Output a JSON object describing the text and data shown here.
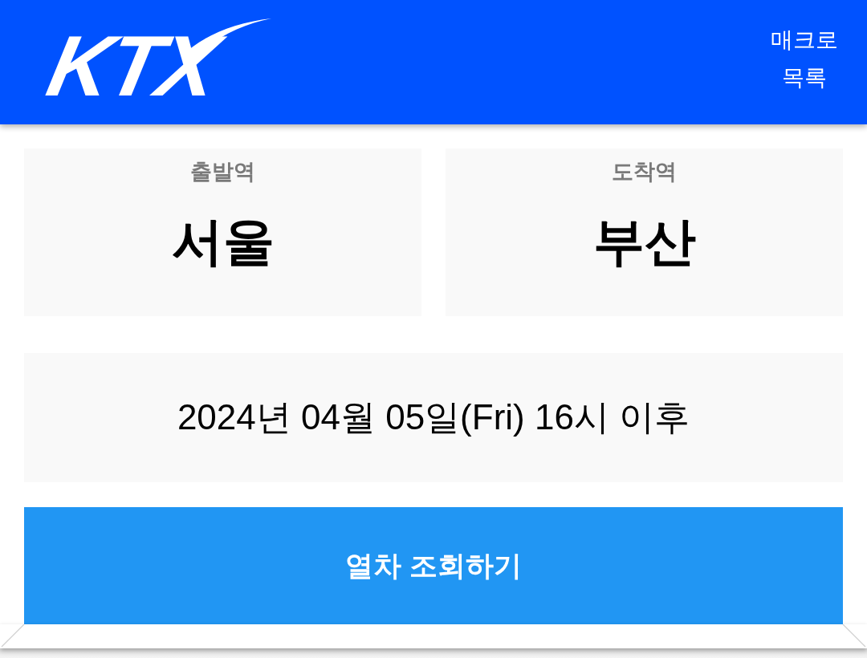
{
  "header": {
    "logo": "KTX",
    "macro_list_button": "매크로 목록"
  },
  "stations": [
    {
      "label": "출발역",
      "name": "서울"
    },
    {
      "label": "도착역",
      "name": "부산"
    }
  ],
  "date_time": "2024년 04월 05일(Fri) 16시 이후",
  "search_button": "열차 조회하기"
}
